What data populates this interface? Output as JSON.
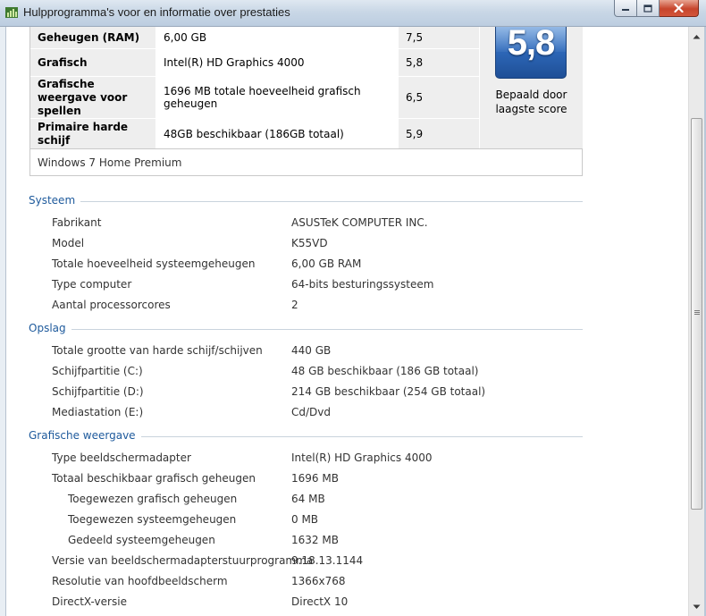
{
  "window": {
    "title": "Hulpprogramma's voor en informatie over prestaties"
  },
  "score_table": {
    "rows": [
      {
        "component": "Geheugen (RAM)",
        "details": "6,00 GB",
        "subscore": "7,5"
      },
      {
        "component": "Grafisch",
        "details": "Intel(R) HD Graphics 4000",
        "subscore": "5,8"
      },
      {
        "component": "Grafische weergave voor spellen",
        "details": "1696 MB totale hoeveelheid grafisch geheugen",
        "subscore": "6,5"
      },
      {
        "component": "Primaire harde schijf",
        "details": "48GB beschikbaar (186GB totaal)",
        "subscore": "5,9"
      }
    ],
    "base_score": "5,8",
    "base_caption": "Bepaald door laagste score",
    "os_edition": "Windows 7 Home Premium"
  },
  "sections": {
    "system": {
      "title": "Systeem",
      "rows": [
        {
          "label": "Fabrikant",
          "value": "ASUSTeK COMPUTER INC."
        },
        {
          "label": "Model",
          "value": "K55VD"
        },
        {
          "label": "Totale hoeveelheid systeemgeheugen",
          "value": "6,00 GB RAM"
        },
        {
          "label": "Type computer",
          "value": "64-bits besturingssysteem"
        },
        {
          "label": "Aantal processorcores",
          "value": "2"
        }
      ]
    },
    "storage": {
      "title": "Opslag",
      "rows": [
        {
          "label": "Totale grootte van harde schijf/schijven",
          "value": "440 GB"
        },
        {
          "label": "Schijfpartitie (C:)",
          "value": "48 GB beschikbaar (186 GB totaal)"
        },
        {
          "label": "Schijfpartitie (D:)",
          "value": "214 GB beschikbaar (254 GB totaal)"
        },
        {
          "label": "Mediastation (E:)",
          "value": "Cd/Dvd"
        }
      ]
    },
    "graphics": {
      "title": "Grafische weergave",
      "rows": [
        {
          "label": "Type beeldschermadapter",
          "value": "Intel(R) HD Graphics 4000"
        },
        {
          "label": "Totaal beschikbaar grafisch geheugen",
          "value": "1696 MB"
        },
        {
          "label": "Toegewezen grafisch geheugen",
          "value": "64 MB"
        },
        {
          "label": "Toegewezen systeemgeheugen",
          "value": "0 MB"
        },
        {
          "label": "Gedeeld systeemgeheugen",
          "value": "1632 MB"
        },
        {
          "label": "Versie van beeldschermadapterstuurprogramma",
          "value": "9.18.13.1144"
        },
        {
          "label": "Resolutie van hoofdbeeldscherm",
          "value": "1366x768"
        },
        {
          "label": "DirectX-versie",
          "value": "DirectX 10"
        }
      ]
    }
  },
  "icons": {
    "app": "performance-icon",
    "minimize": "minimize-icon",
    "maximize": "maximize-icon",
    "close": "close-icon",
    "scroll_up": "arrow-up-icon",
    "scroll_down": "arrow-down-icon"
  },
  "colors": {
    "section_heading": "#1e5a9c",
    "badge": "#2f6bbd",
    "close_button": "#c7452c"
  }
}
